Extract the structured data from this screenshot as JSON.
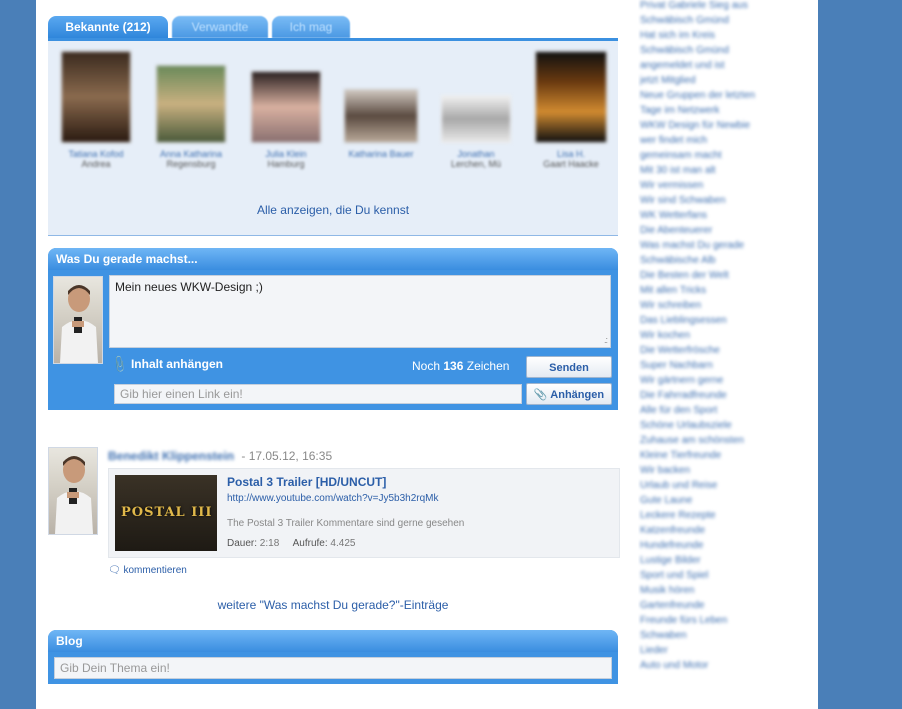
{
  "tabs": [
    {
      "label": "Bekannte (212)",
      "active": true
    },
    {
      "label": "Verwandte",
      "active": false
    },
    {
      "label": "Ich mag",
      "active": false
    }
  ],
  "friends": {
    "show_all": "Alle anzeigen, die Du kennst",
    "items": [
      {
        "name": "Tatiana Kofod",
        "sub": "Andrea"
      },
      {
        "name": "Anna Katharina",
        "sub": "Regensburg"
      },
      {
        "name": "Julia Klein",
        "sub": "Hamburg"
      },
      {
        "name": "Katharina Bauer",
        "sub": ""
      },
      {
        "name": "Jonathan",
        "sub": "Lerchen, Mü"
      },
      {
        "name": "Lisa H.",
        "sub": "Gaart Haacke"
      }
    ]
  },
  "status": {
    "header": "Was Du gerade machst...",
    "text": "Mein neues WKW-Design ;)",
    "attach_label": "Inhalt anhängen",
    "counter_prefix": "Noch",
    "counter_value": "136",
    "counter_suffix": "Zeichen",
    "send_label": "Senden",
    "link_placeholder": "Gib hier einen Link ein!",
    "attach_button": "Anhängen"
  },
  "feed": {
    "author": "Benedikt Klippenstein",
    "timestamp": "- 17.05.12, 16:35",
    "video_thumb_text": "POSTAL III",
    "video_title": "Postal 3 Trailer [HD/UNCUT]",
    "video_url": "http://www.youtube.com/watch?v=Jy5b3h2rqMk",
    "video_desc": "The Postal 3 Trailer Kommentare sind gerne gesehen",
    "duration_label": "Dauer:",
    "duration_value": "2:18",
    "views_label": "Aufrufe:",
    "views_value": "4.425",
    "comment_label": "kommentieren",
    "more_label": "weitere \"Was machst Du gerade?\"-Einträge"
  },
  "blog": {
    "header": "Blog",
    "placeholder": "Gib Dein Thema ein!"
  },
  "right_column": {
    "lines": [
      "Privat Gabriele Sieg aus",
      "Schwäbisch Gmünd",
      "Hat sich im Kreis",
      "Schwäbisch Gmünd",
      "angemeldet und ist",
      "jetzt Mitglied",
      "Neue Gruppen der letzten",
      "Tage im Netzwerk",
      "WKW Design für Newbie",
      "wer findet mich",
      "gemeinsam macht",
      "Mit 30 ist man alt",
      "Wir vermissen",
      "Wir sind Schwaben",
      "WK Wetterfans",
      "Die Abenteuerer",
      "Was machst Du gerade",
      "Schwäbische Alb",
      "Die Besten der Welt",
      "Mit allen Tricks",
      "Wir schreiben",
      "Das Lieblingsessen",
      "Wir kochen",
      "Die Wetterfrösche",
      "Super Nachbarn",
      "Wir gärtnern gerne",
      "Die Fahrradfreunde",
      "Alle für den Sport",
      "Schöne Urlaubsziele",
      "Zuhause am schönsten",
      "Kleine Tierfreunde",
      "Wir backen",
      "Urlaub und Reise",
      "Gute Laune",
      "Leckere Rezepte",
      "Katzenfreunde",
      "Hundefreunde",
      "Lustige Bilder",
      "Sport und Spiel",
      "Musik hören",
      "Gartenfreunde",
      "Freunde fürs Leben",
      "Schwaben",
      "Lieder",
      "Auto und Motor"
    ]
  }
}
